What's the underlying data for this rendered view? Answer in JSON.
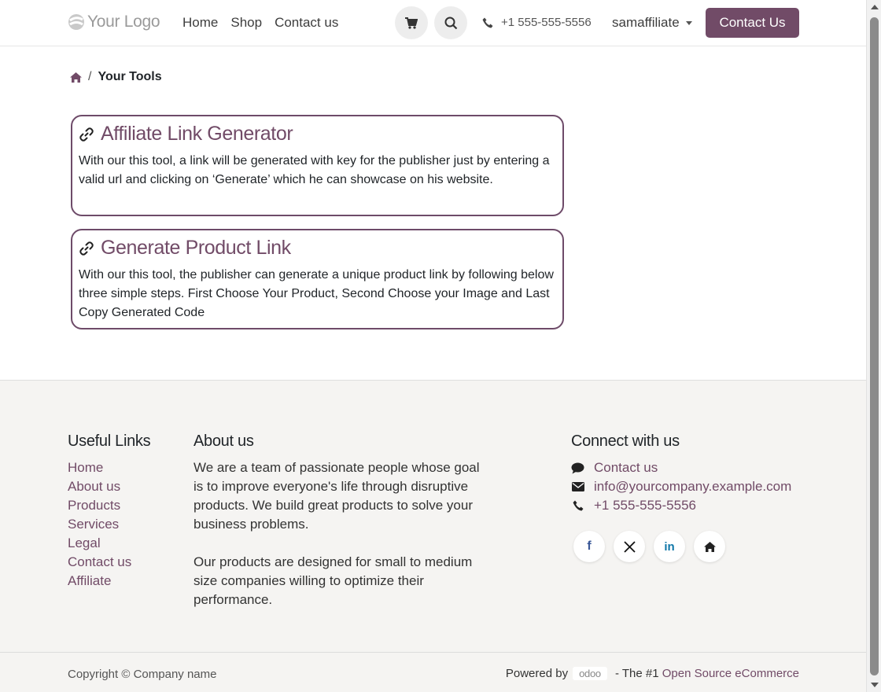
{
  "header": {
    "logo_text": "Your Logo",
    "nav": [
      "Home",
      "Shop",
      "Contact us"
    ],
    "phone": "+1 555-555-5556",
    "user": "samaffiliate",
    "cta_label": "Contact Us"
  },
  "breadcrumb": {
    "current": "Your Tools"
  },
  "cards": [
    {
      "title": "Affiliate Link Generator",
      "text": "With our this tool, a link will be generated with key for the publisher just by entering a valid url and clicking on ‘Generate’ which he can showcase on his website."
    },
    {
      "title": "Generate Product Link",
      "text": "With our this tool, the publisher can generate a unique product link by following below three simple steps. First Choose Your Product, Second Choose your Image and Last Copy Generated Code"
    }
  ],
  "footer": {
    "useful_links_title": "Useful Links",
    "useful_links": [
      "Home",
      "About us",
      "Products",
      "Services",
      "Legal",
      "Contact us",
      "Affiliate"
    ],
    "about_title": "About us",
    "about_p1": "We are a team of passionate people whose goal is to improve everyone's life through disruptive products. We build great products to solve your business problems.",
    "about_p2": "Our products are designed for small to medium size companies willing to optimize their performance.",
    "connect_title": "Connect with us",
    "contact_label": "Contact us",
    "email": "info@yourcompany.example.com",
    "phone": "+1 555-555-5556",
    "copyright": "Copyright © Company name",
    "powered_by": "Powered by",
    "odoo": "odoo",
    "tagline_dash": " - The #1 ",
    "tagline_link": "Open Source eCommerce"
  },
  "colors": {
    "brand": "#714b67",
    "footer_bg": "#f5f4f2"
  }
}
